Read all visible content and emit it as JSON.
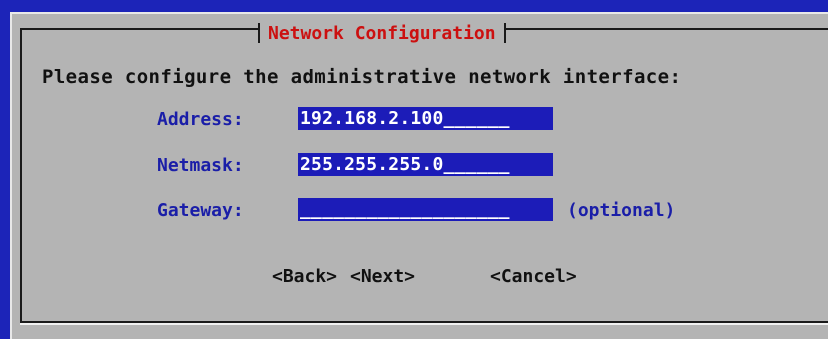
{
  "dialog": {
    "title": "Network Configuration",
    "prompt": "Please configure the administrative network interface:"
  },
  "fields": {
    "address": {
      "label": "Address:",
      "value": "192.168.2.100______"
    },
    "netmask": {
      "label": "Netmask:",
      "value": "255.255.255.0______"
    },
    "gateway": {
      "label": "Gateway:",
      "value": "___________________",
      "note": "(optional)"
    }
  },
  "buttons": {
    "back": "<Back>",
    "next": "<Next>",
    "cancel": "<Cancel>"
  },
  "colors": {
    "background": "#1c24b8",
    "dialog": "#b4b4b4",
    "title": "#cc1010",
    "label": "#1a1ea8",
    "field_bg": "#1c1cb8",
    "field_text": "#ffffff"
  }
}
